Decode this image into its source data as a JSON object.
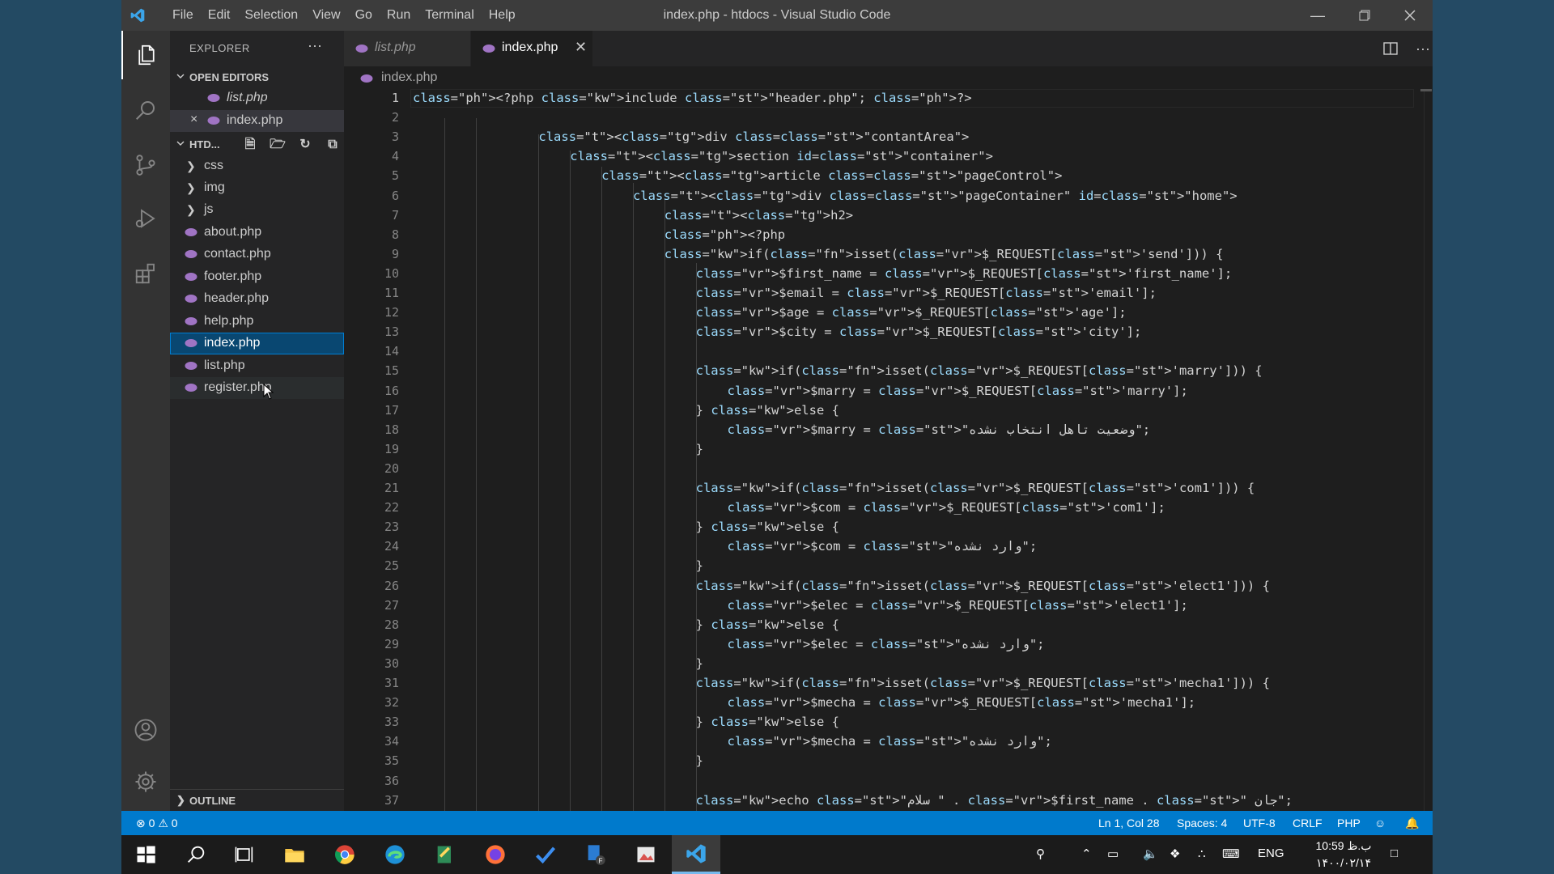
{
  "window": {
    "title": "index.php - htdocs - Visual Studio Code",
    "menu": [
      "File",
      "Edit",
      "Selection",
      "View",
      "Go",
      "Run",
      "Terminal",
      "Help"
    ]
  },
  "sidebar": {
    "title": "EXPLORER",
    "open_editors_label": "OPEN EDITORS",
    "open_editors": [
      "list.php",
      "index.php"
    ],
    "folder_label": "HTD...",
    "folders": [
      "css",
      "img",
      "js"
    ],
    "files": [
      "about.php",
      "contact.php",
      "footer.php",
      "header.php",
      "help.php",
      "index.php",
      "list.php",
      "register.php"
    ],
    "outline_label": "OUTLINE"
  },
  "tabs": [
    {
      "label": "list.php",
      "preview": true
    },
    {
      "label": "index.php",
      "active": true
    }
  ],
  "breadcrumb": "index.php",
  "editor": {
    "line_numbers": [
      "1",
      "2",
      "3",
      "4",
      "5",
      "6",
      "7",
      "8",
      "9",
      "10",
      "11",
      "12",
      "13",
      "14",
      "15",
      "16",
      "17",
      "18",
      "19",
      "20",
      "21",
      "22",
      "23",
      "24",
      "25",
      "26",
      "27",
      "28",
      "29",
      "30",
      "31",
      "32",
      "33",
      "34",
      "35",
      "36",
      "37"
    ],
    "current_line": 1,
    "lines": [
      "<?php include \"header.php\"; ?>",
      "",
      "<div class=\"contantArea\">",
      "<section id=\"container\">",
      "<article class=\"pageControl\">",
      "<div class=\"pageContainer\" id=\"home\">",
      "<h2>",
      "<?php",
      "if(isset($_REQUEST['send'])) {",
      "$first_name = $_REQUEST['first_name'];",
      "$email = $_REQUEST['email'];",
      "$age = $_REQUEST['age'];",
      "$city = $_REQUEST['city'];",
      "",
      "if(isset($_REQUEST['marry'])) {",
      "$marry = $_REQUEST['marry'];",
      "} else {",
      "$marry = \"وضعیت تاهل انتخاب نشده\";",
      "}",
      "",
      "if(isset($_REQUEST['com1'])) {",
      "$com = $_REQUEST['com1'];",
      "} else {",
      "$com = \"وارد نشده\";",
      "}",
      "if(isset($_REQUEST['elect1'])) {",
      "$elec = $_REQUEST['elect1'];",
      "} else {",
      "$elec = \"وارد نشده\";",
      "}",
      "if(isset($_REQUEST['mecha1'])) {",
      "$mecha = $_REQUEST['mecha1'];",
      "} else {",
      "$mecha = \"وارد نشده\";",
      "}",
      "",
      "echo \"سلام \" . $first_name . \" جان\";"
    ]
  },
  "status": {
    "problems": "0",
    "warnings": "0",
    "position": "Ln 1, Col 28",
    "spaces": "Spaces: 4",
    "encoding": "UTF-8",
    "eol": "CRLF",
    "language": "PHP"
  },
  "taskbar": {
    "language": "ENG",
    "time": "10:59 ب.ظ",
    "date": "۱۴۰۰/۰۲/۱۴"
  },
  "colors": {
    "accent": "#007acc",
    "selection": "#094771"
  }
}
